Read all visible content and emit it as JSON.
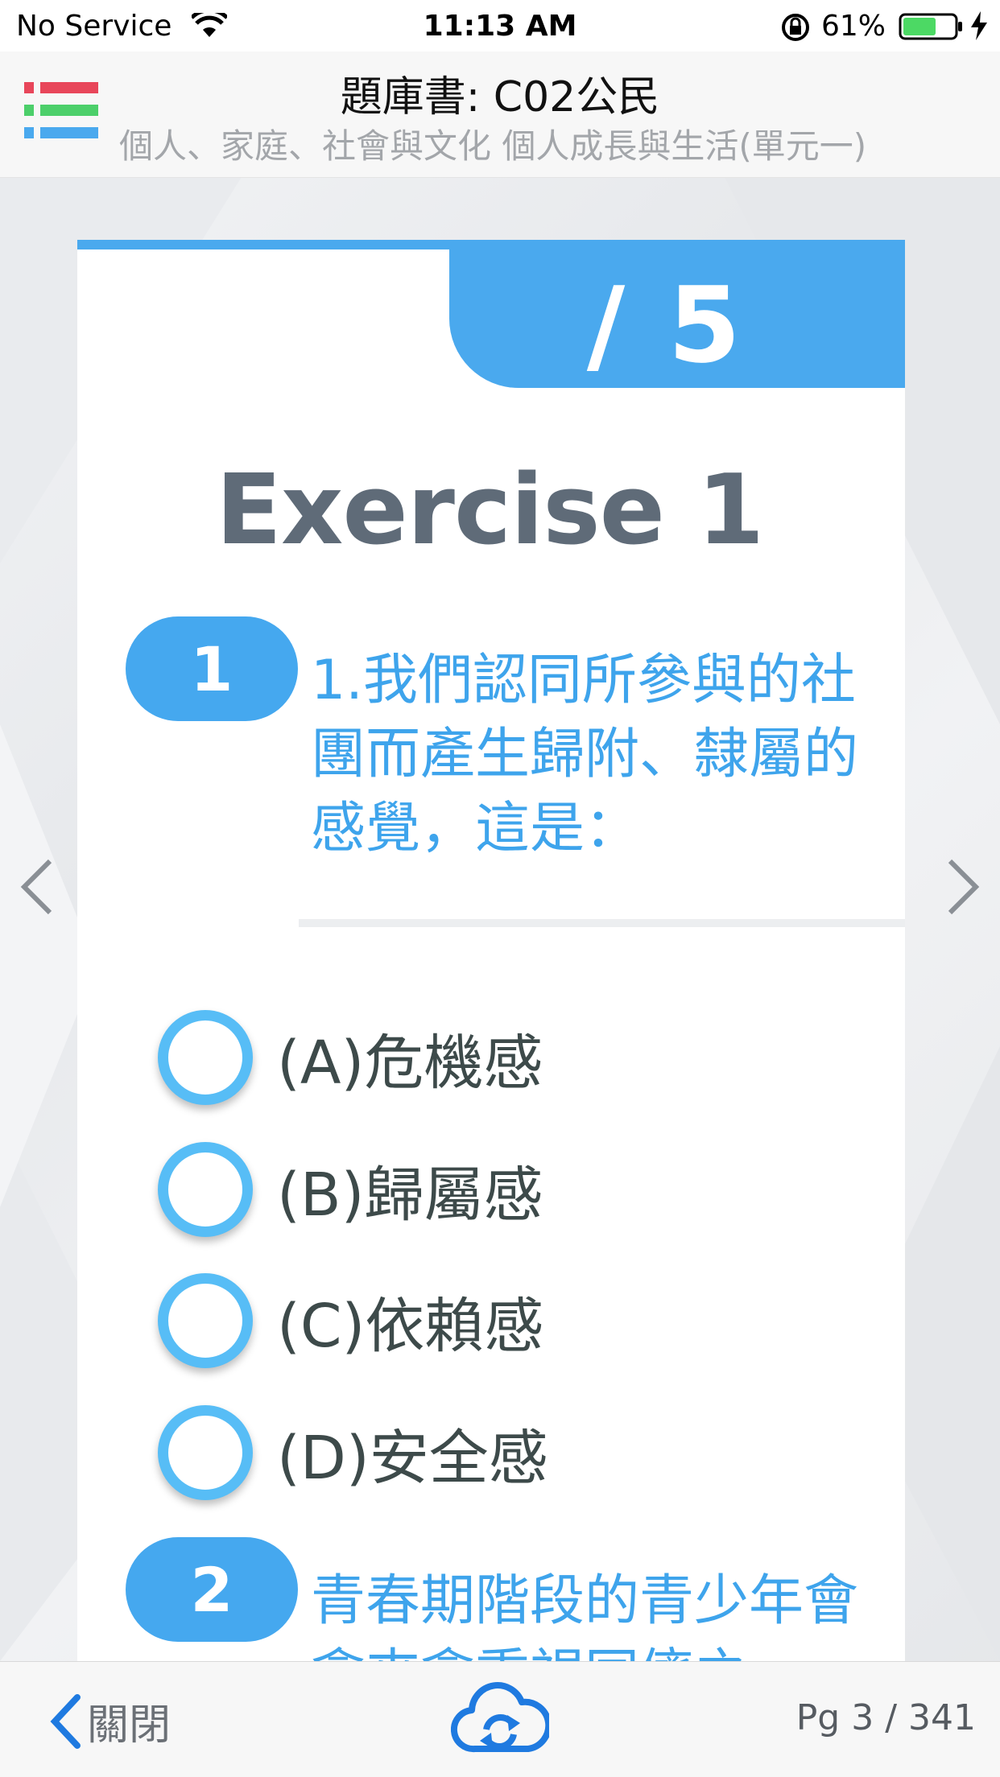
{
  "status_bar": {
    "carrier": "No Service",
    "time": "11:13 AM",
    "battery": "61%"
  },
  "header": {
    "title": "題庫書: C02公民",
    "subtitle": "個人、家庭、社會與文化 個人成長與生活(單元一)"
  },
  "card": {
    "page_count": "/ 5",
    "title": "Exercise 1",
    "questions": [
      {
        "number": "1",
        "text": "1.我們認同所參與的社團而產生歸附、隸屬的感覺，這是："
      },
      {
        "number": "2",
        "text": "青春期階段的青少年會愈來愈重視同儕之"
      }
    ],
    "options": [
      {
        "label": "(A)危機感"
      },
      {
        "label": "(B)歸屬感"
      },
      {
        "label": "(C)依賴感"
      },
      {
        "label": "(D)安全感"
      }
    ]
  },
  "toolbar": {
    "close_label": "關閉",
    "page_indicator": "Pg 3 / 341"
  },
  "colors": {
    "accent": "#4aa9ee",
    "radio": "#57bdf6",
    "question_text": "#3ea4ec",
    "title_text": "#5f6b78"
  },
  "icons": {
    "menu": "menu-icon",
    "prev": "chevron-left-icon",
    "next": "chevron-right-icon",
    "sync": "cloud-sync-icon",
    "back": "chevron-left-icon"
  }
}
